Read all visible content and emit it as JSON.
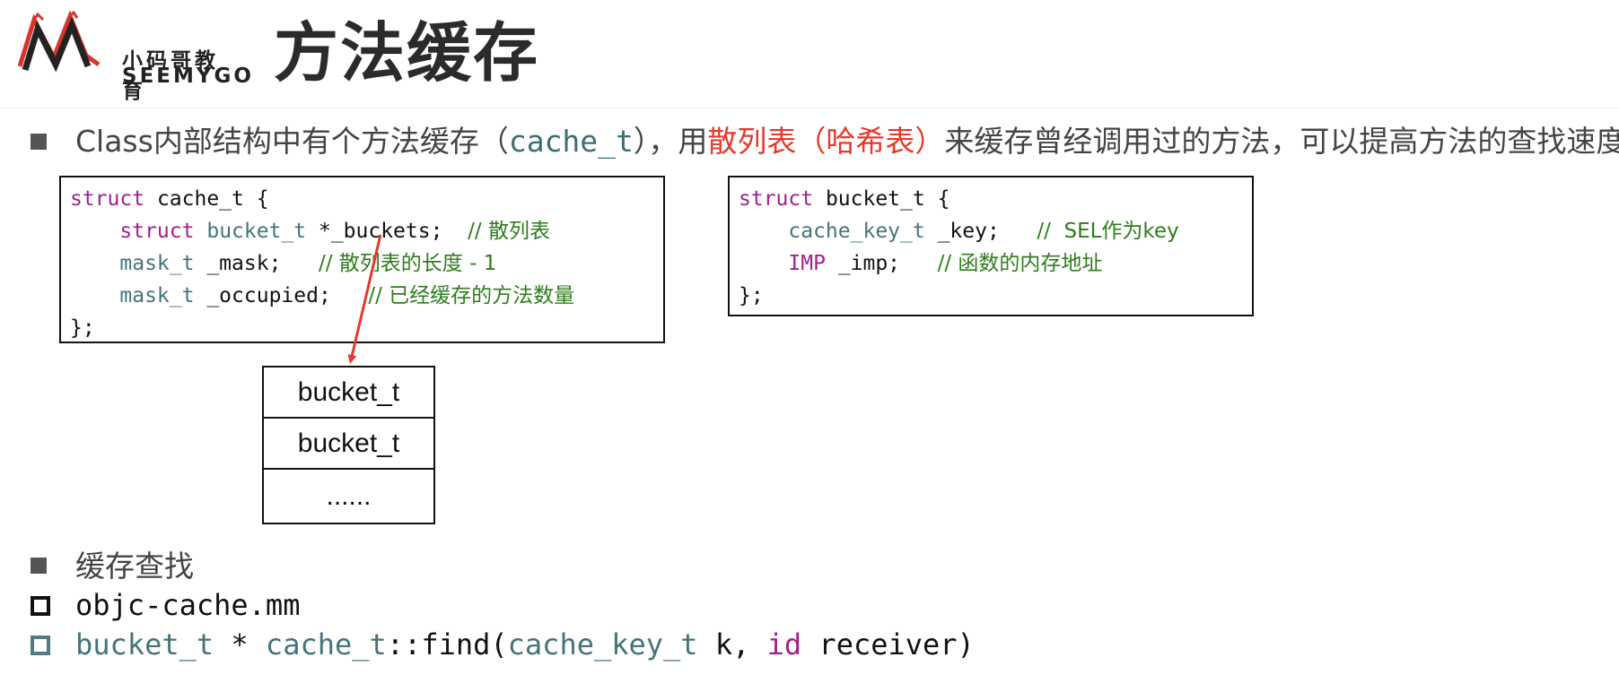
{
  "header": {
    "logo": {
      "text_cn": "小码哥教育",
      "text_en": "SEEMYGO"
    },
    "title": "方法缓存"
  },
  "intro": {
    "prefix": "Class内部结构中有个方法缓存（",
    "code": "cache_t",
    "middle": "），用",
    "highlight": "散列表（哈希表）",
    "suffix": "来缓存曾经调用过的方法，可以提高方法的查找速度"
  },
  "cache_struct": {
    "l1_kw": "struct",
    "l1_rest": " cache_t {",
    "l2_kw": "struct",
    "l2_type": "bucket_t",
    "l2_field": " *_buckets;",
    "l2_comment": "// 散列表",
    "l3_type": "mask_t",
    "l3_field": " _mask;",
    "l3_comment": "// 散列表的长度 - 1",
    "l4_type": "mask_t",
    "l4_field": " _occupied;",
    "l4_comment": "// 已经缓存的方法数量",
    "l5": "};"
  },
  "bucket_struct": {
    "l1_kw": "struct",
    "l1_rest": " bucket_t {",
    "l2_type": "cache_key_t",
    "l2_field": " _key;",
    "l2_comment": "//  SEL作为key",
    "l3_type": "IMP",
    "l3_field": " _imp;",
    "l3_comment": "// 函数的内存地址",
    "l4": "};"
  },
  "bucket_table": {
    "rows": [
      "bucket_t",
      "bucket_t",
      "......"
    ]
  },
  "lookup": {
    "heading": "缓存查找",
    "file": "objc-cache.mm",
    "sig_type1": "bucket_t",
    "sig_star": " * ",
    "sig_type2": "cache_t",
    "sig_fn": "::find(",
    "sig_type3": "cache_key_t",
    "sig_arg": " k, ",
    "sig_kw": "id",
    "sig_end": " receiver)"
  },
  "colors": {
    "keyword": "#a0218c",
    "type": "#45747a",
    "comment": "#2e7d1c",
    "highlight": "#e53a2b",
    "arrow": "#e53a2b",
    "logo_red": "#d9342b"
  }
}
